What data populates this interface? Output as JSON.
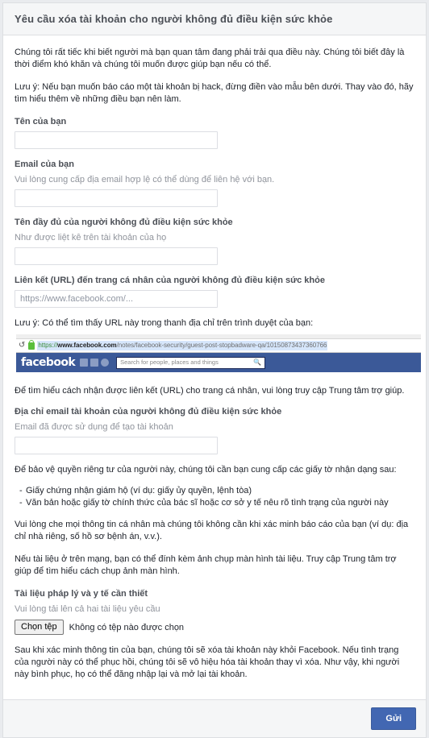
{
  "header": {
    "title": "Yêu cầu xóa tài khoản cho người không đủ điều kiện sức khỏe"
  },
  "body": {
    "intro_paragraph": "Chúng tôi rất tiếc khi biết người mà bạn quan tâm đang phải trải qua điều này. Chúng tôi biết đây là thời điểm khó khăn và chúng tôi muốn được giúp bạn nếu có thể.",
    "hack_notice": "Lưu ý: Nếu bạn muốn báo cáo một tài khoản bị hack, đừng điền vào mẫu bên dưới. Thay vào đó, hãy tìm hiểu thêm về những điều bạn nên làm.",
    "your_name": {
      "label": "Tên của bạn",
      "value": "",
      "placeholder": ""
    },
    "your_email": {
      "label": "Email của bạn",
      "sub": "Vui lòng cung cấp địa email hợp lệ có thể dùng để liên hệ với bạn.",
      "value": "",
      "placeholder": ""
    },
    "full_name": {
      "label": "Tên đầy đủ của người không đủ điều kiện sức khỏe",
      "sub": "Như được liệt kê trên tài khoản của họ",
      "value": "",
      "placeholder": ""
    },
    "profile_url": {
      "label": "Liên kết (URL) đến trang cá nhân của người không đủ điều kiện sức khỏe",
      "value": "",
      "placeholder": "https://www.facebook.com/..."
    },
    "url_hint": "Lưu ý: Có thể tìm thấy URL này trong thanh địa chỉ trên trình duyệt của bạn:",
    "browser_screenshot": {
      "url_scheme": "https://",
      "url_domain": "www.facebook.com",
      "url_path": "/notes/facebook-security/guest-post-stopbadware-qa/10150873437360766",
      "brand": "facebook",
      "search_placeholder": "Search for people, places and things"
    },
    "help_center_line": "Để tìm hiểu cách nhận được liên kết (URL) cho trang cá nhân, vui lòng truy cập Trung tâm trợ giúp.",
    "account_email": {
      "label": "Địa chỉ email tài khoản của người không đủ điều kiện sức khỏe",
      "sub": "Email đã được sử dụng để tạo tài khoản",
      "value": "",
      "placeholder": ""
    },
    "privacy_intro": "Để bảo vệ quyền riêng tư của người này, chúng tôi cần bạn cung cấp các giấy tờ nhận dạng sau:",
    "doc_bullets": [
      "Giấy chứng nhận giám hộ (ví dụ: giấy ủy quyền, lệnh tòa)",
      "Văn bản hoặc giấy tờ chính thức của bác sĩ hoặc cơ sở y tế nêu rõ tình trạng của người này"
    ],
    "redact_note": "Vui lòng che mọi thông tin cá nhân mà chúng tôi không cần khi xác minh báo cáo của bạn (ví dụ: địa chỉ nhà riêng, số hồ sơ bệnh án, v.v.).",
    "screenshot_note": "Nếu tài liệu ở trên mạng, bạn có thể đính kèm ảnh chụp màn hình tài liệu. Truy cập Trung tâm trợ giúp để tìm hiểu cách chụp ảnh màn hình.",
    "upload": {
      "label": "Tài liệu pháp lý và y tế cần thiết",
      "sub": "Vui lòng tải lên cả hai tài liệu yêu cầu",
      "button_label": "Chọn tệp",
      "status": "Không có tệp nào được chọn"
    },
    "closing_paragraph": "Sau khi xác minh thông tin của bạn, chúng tôi sẽ xóa tài khoản này khỏi Facebook. Nếu tình trạng của người này có thể phục hồi, chúng tôi sẽ vô hiệu hóa tài khoản thay vì xóa. Như vậy, khi người này bình phục, họ có thể đăng nhập lại và mở lại tài khoản."
  },
  "footer": {
    "submit_label": "Gửi"
  },
  "colors": {
    "accent": "#4267b2",
    "fb_bar": "#3b5998",
    "page_bg": "#e9ebee",
    "header_bg": "#f5f6f7",
    "text": "#1d2129",
    "muted": "#90949c"
  }
}
